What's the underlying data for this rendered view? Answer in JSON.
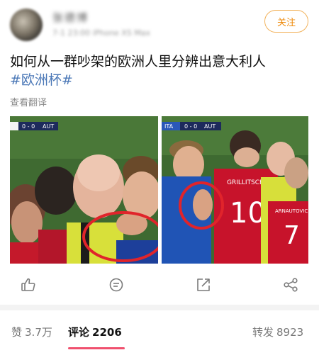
{
  "user": {
    "name": "张德博",
    "meta_time": "7-1 23:00",
    "meta_device": "iPhone XS Max",
    "follow_label": "关注"
  },
  "post": {
    "title": "如何从一群吵架的欧洲人里分辨出意大利人",
    "hashtag": "#欧洲杯#",
    "translate_label": "查看翻译"
  },
  "photos": {
    "left": {
      "scoreboard": "0 - 0",
      "team_right": "AUT"
    },
    "right": {
      "team_left": "ITA",
      "scoreboard": "0 - 0",
      "team_right": "AUT",
      "jersey_name_1": "GRILLITSCH",
      "jersey_number_1": "10",
      "jersey_name_2": "ARNAUTOVIC",
      "jersey_number_2": "7"
    }
  },
  "actions": [
    {
      "icon": "thumbs-up-icon"
    },
    {
      "icon": "comment-icon"
    },
    {
      "icon": "share-icon"
    },
    {
      "icon": "forward-icon"
    }
  ],
  "tabs": {
    "likes": {
      "label": "赞",
      "count": "3.7万"
    },
    "comments": {
      "label": "评论",
      "count": "2206"
    },
    "reposts": {
      "label": "转发",
      "count": "8923"
    }
  },
  "colors": {
    "accent_orange": "#ee8a0b",
    "hashtag_blue": "#4b78b7",
    "tab_indicator": "#f0506e",
    "annotation_red": "#e0242b"
  }
}
